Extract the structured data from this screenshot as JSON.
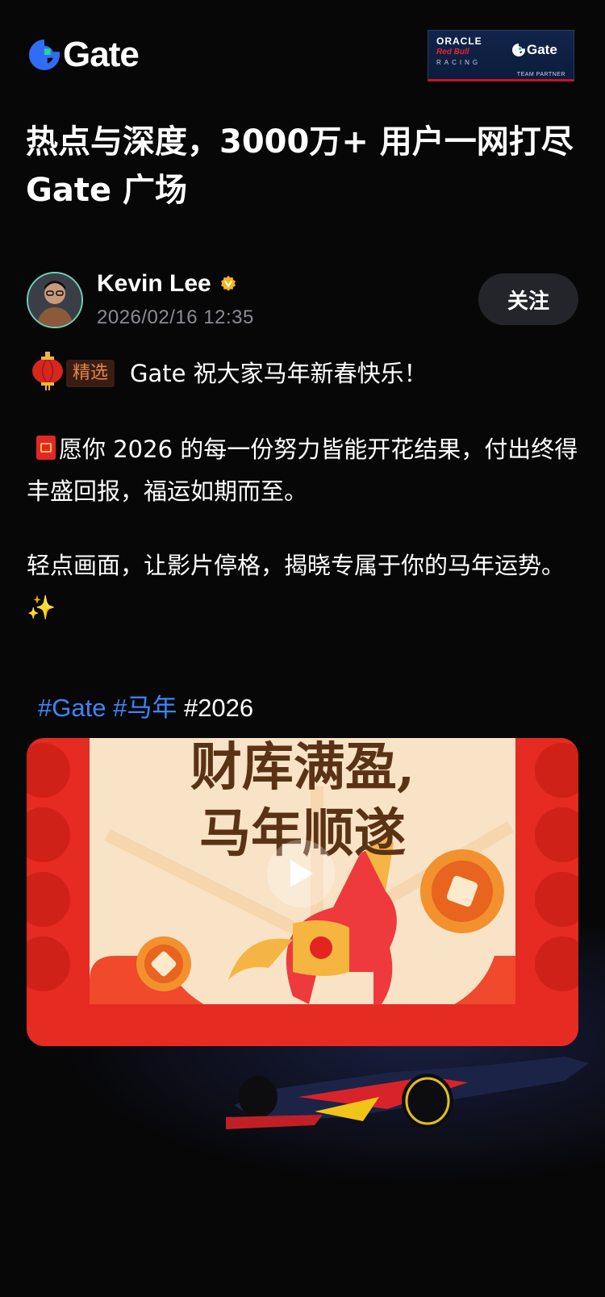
{
  "header": {
    "logo_text": "Gate",
    "partner": {
      "oracle": "ORACLE",
      "redbull": "Red Bull",
      "racing": "RACING",
      "gate": "Gate",
      "team_partner": "TEAM PARTNER"
    }
  },
  "article": {
    "title": "热点与深度，3000万+ 用户一网打尽 Gate 广场"
  },
  "author": {
    "name": "Kevin Lee",
    "time": "2026/02/16 12:35",
    "follow_label": "关注"
  },
  "post": {
    "badge": "精选",
    "line1": "Gate 祝大家马年新春快乐！",
    "para2": "愿你 2026 的每一份努力皆能开花结果，付出终得丰盛回报，福运如期而至。",
    "para3": " 轻点画面，让影片停格，揭晓专属于你的马年运势。",
    "sparkle": "✨",
    "tags": [
      "#Gate",
      "#马年",
      "#2026"
    ]
  },
  "media": {
    "headline1": "财库满盈,",
    "headline2": "马年顺遂"
  },
  "colors": {
    "background": "#070708",
    "brand_blue": "#3b86f7",
    "badge_text": "#e0844f",
    "festive_red": "#e52b22"
  },
  "icons": [
    "gate-logo-icon",
    "verified-badge-icon",
    "lantern-icon",
    "red-envelope-icon",
    "play-icon"
  ]
}
